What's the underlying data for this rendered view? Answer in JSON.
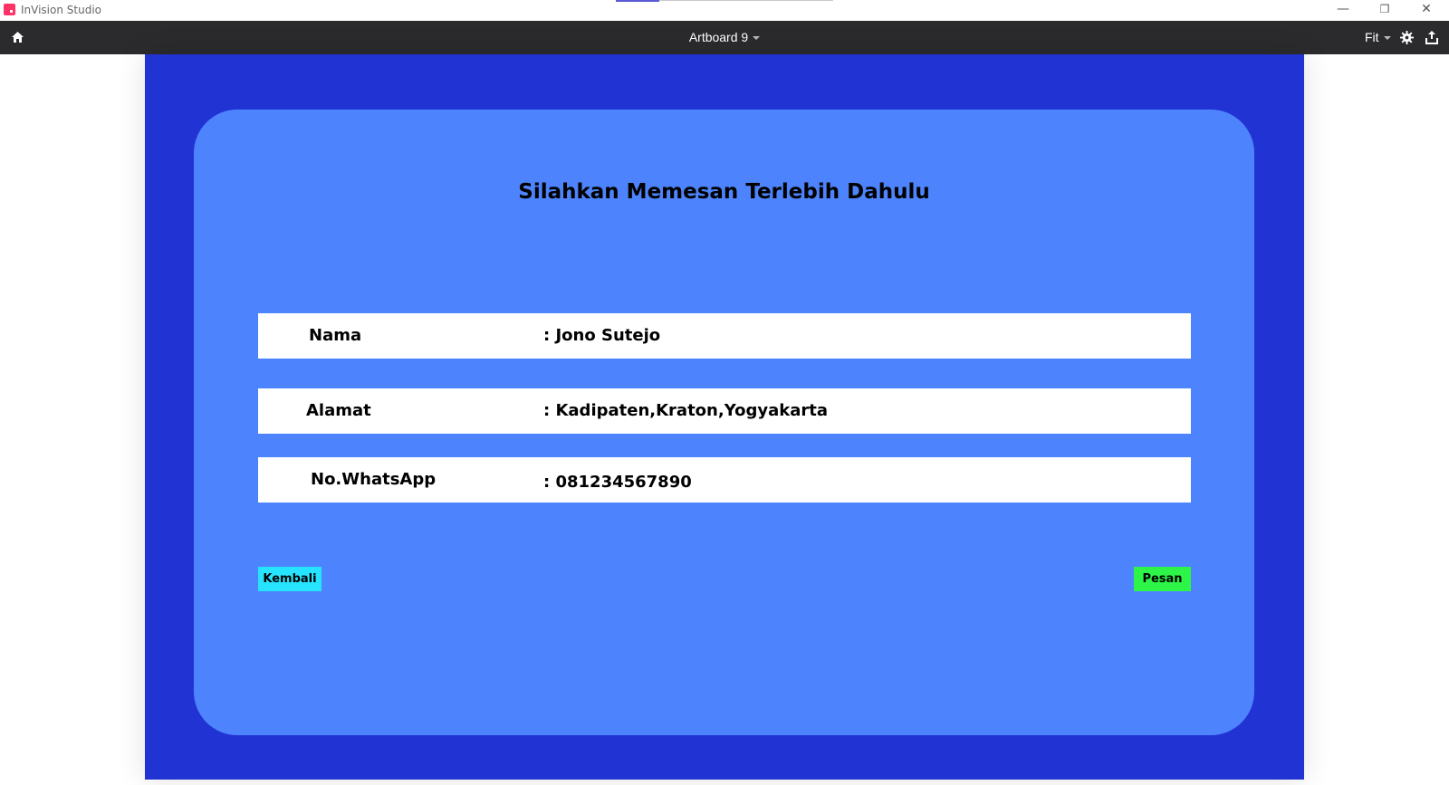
{
  "window": {
    "app_title": "InVision Studio",
    "minimize_glyph": "—",
    "maximize_glyph": "❐",
    "close_glyph": "✕"
  },
  "toolbar": {
    "artboard_name": "Artboard 9",
    "zoom_label": "Fit",
    "icons": [
      "home-icon",
      "chevron-down-icon",
      "gear-icon",
      "share-icon"
    ]
  },
  "colors": {
    "artboard_bg": "#2233d4",
    "card_bg": "#4d84fd",
    "back_button": "#26e4ff",
    "order_button": "#2df547",
    "toolbar_bg": "#2b2b2e"
  },
  "form": {
    "title": "Silahkan Memesan Terlebih Dahulu",
    "rows": [
      {
        "label": "Nama",
        "value": ": Jono Sutejo"
      },
      {
        "label": "Alamat",
        "value": ": Kadipaten,Kraton,Yogyakarta"
      },
      {
        "label": "No.WhatsApp",
        "value": ": 081234567890"
      }
    ],
    "back_label": "Kembali",
    "order_label": "Pesan"
  }
}
